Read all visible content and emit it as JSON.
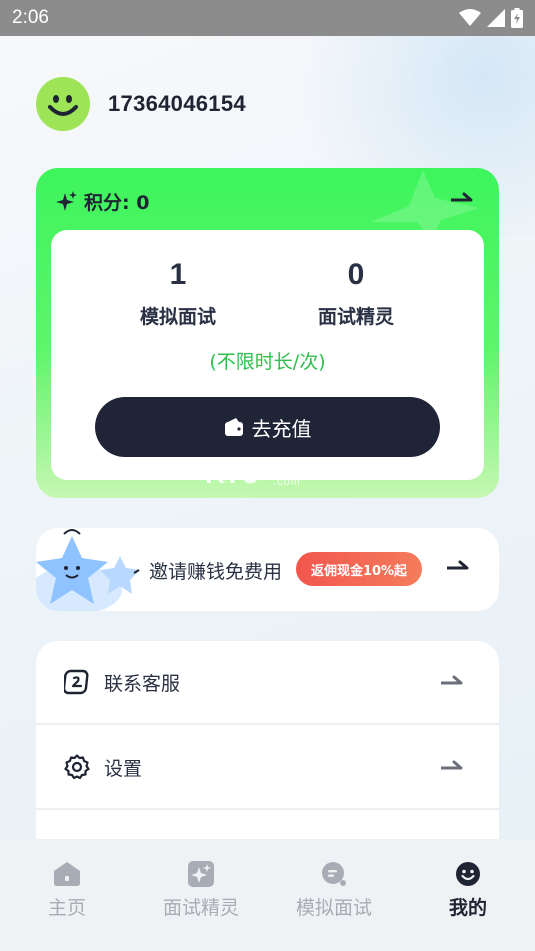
{
  "status_bar": {
    "time": "2:06"
  },
  "profile": {
    "phone": "17364046154"
  },
  "points_card": {
    "points_label": "积分: 0",
    "stats": [
      {
        "value": "1",
        "label": "模拟面试"
      },
      {
        "value": "0",
        "label": "面试精灵"
      }
    ],
    "unlimited_note": "(不限时长/次)",
    "recharge_label": "去充值"
  },
  "watermark": {
    "brand": "K73",
    "cn": "游戏之家",
    "domain": ".com"
  },
  "invite": {
    "text": "邀请赚钱免费用",
    "badge": "返佣现金10%起"
  },
  "menu": [
    {
      "label": "联系客服",
      "icon": "customer-service-icon"
    },
    {
      "label": "设置",
      "icon": "gear-icon"
    }
  ],
  "tabs": [
    {
      "label": "主页",
      "icon": "home-icon",
      "active": false
    },
    {
      "label": "面试精灵",
      "icon": "sparkle-icon",
      "active": false
    },
    {
      "label": "模拟面试",
      "icon": "chat-icon",
      "active": false
    },
    {
      "label": "我的",
      "icon": "smiley-icon",
      "active": true
    }
  ],
  "colors": {
    "accent_green": "#3df55c",
    "dark_button": "#202437",
    "note_green": "#2fbf4a",
    "badge_red": "#f2564d"
  }
}
